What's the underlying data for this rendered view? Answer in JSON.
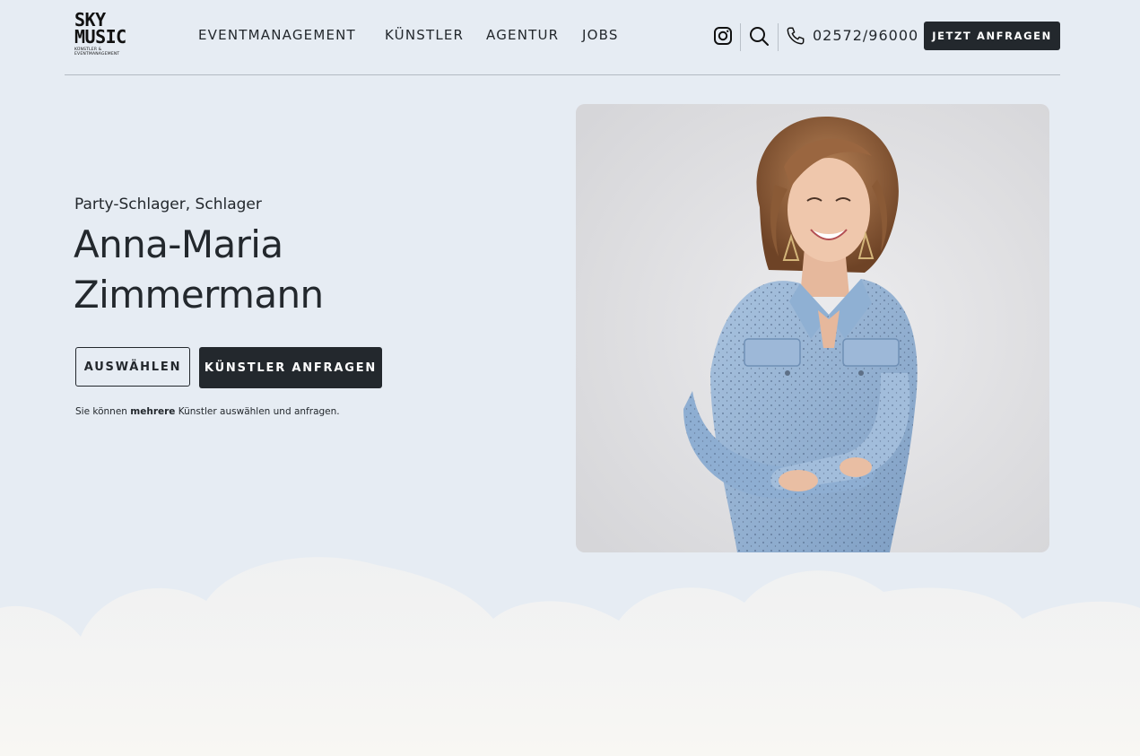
{
  "brand": {
    "line1": "SKY",
    "line2": "MUSIC",
    "line3": "KÜNSTLER & EVENTMANAGEMENT"
  },
  "nav": {
    "items": [
      {
        "label": "EVENTMANAGEMENT"
      },
      {
        "label": "KÜNSTLER"
      },
      {
        "label": "AGENTUR"
      },
      {
        "label": "JOBS"
      }
    ]
  },
  "header": {
    "instagram_icon": "instagram-icon",
    "search_icon": "search-icon",
    "phone_icon": "phone-icon",
    "phone": "02572/96000",
    "cta": "JETZT ANFRAGEN"
  },
  "hero": {
    "genre": "Party-Schlager, Schlager",
    "name_line1": "Anna-Maria",
    "name_line2": "Zimmermann",
    "select_button": "AUSWÄHLEN",
    "request_button": "KÜNSTLER ANFRAGEN",
    "note_pre": "Sie können ",
    "note_bold": "mehrere",
    "note_post": " Künstler auswählen und anfragen."
  },
  "colors": {
    "background": "#e6ecf3",
    "dark": "#23282d",
    "cloud": "#f3f3f3",
    "footer_bg": "#f7f6f2"
  }
}
